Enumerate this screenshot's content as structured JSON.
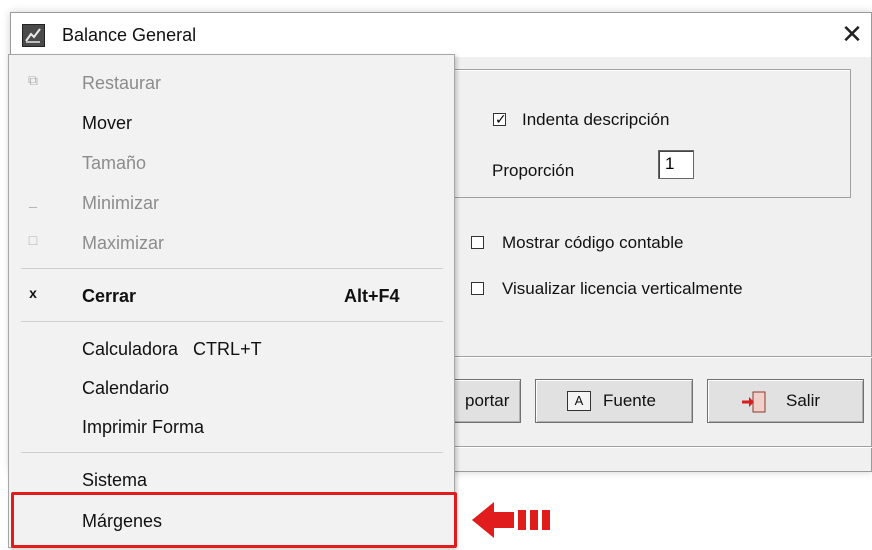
{
  "window": {
    "title": "Balance General",
    "close_glyph": "✕"
  },
  "options": {
    "indent_label": "Indenta descripción",
    "indent_checked": true,
    "proportion_label": "Proporción",
    "proportion_value": "1",
    "show_code_label": "Mostrar código contable",
    "show_code_checked": false,
    "vertical_license_label": "Visualizar licencia verticalmente",
    "vertical_license_checked": false
  },
  "buttons": {
    "export_partial": "portar",
    "font_label": "Fuente",
    "font_icon_letter": "A",
    "exit_label": "Salir"
  },
  "system_menu": {
    "items": [
      {
        "label": "Restaurar",
        "icon": "restore-icon",
        "enabled": false
      },
      {
        "label": "Mover",
        "icon": "",
        "enabled": true
      },
      {
        "label": "Tamaño",
        "icon": "",
        "enabled": false
      },
      {
        "label": "Minimizar",
        "icon": "minimize-icon",
        "enabled": false
      },
      {
        "label": "Maximizar",
        "icon": "maximize-icon",
        "enabled": false
      },
      {
        "label": "Cerrar",
        "icon": "close-icon",
        "enabled": true,
        "bold": true,
        "shortcut": "Alt+F4"
      },
      {
        "label": "Calculadora   CTRL+T",
        "icon": "",
        "enabled": true
      },
      {
        "label": "Calendario",
        "icon": "",
        "enabled": true
      },
      {
        "label": "Imprimir Forma",
        "icon": "",
        "enabled": true
      },
      {
        "label": "Sistema",
        "icon": "",
        "enabled": true
      },
      {
        "label": "Márgenes",
        "icon": "",
        "enabled": true,
        "highlighted": true
      }
    ]
  },
  "colors": {
    "highlight_border": "#e01c1c",
    "arrow": "#e01c1c",
    "dialog_bg": "#f0f0f0",
    "menu_bg": "#f2f2f2"
  }
}
